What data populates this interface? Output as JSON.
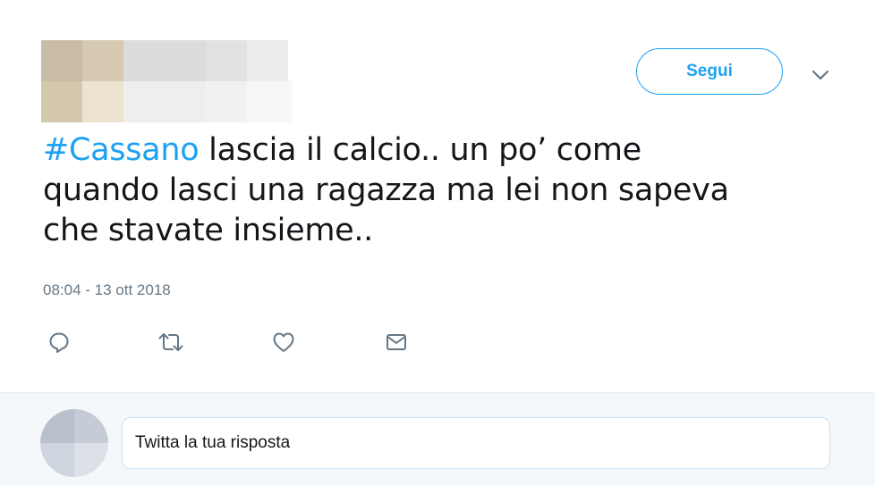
{
  "header": {
    "follow_label": "Segui"
  },
  "tweet": {
    "hashtag": "#Cassano",
    "text_line1_rest": " lascia il calcio.. un po’ come",
    "text_line2": "quando lasci una ragazza ma lei non sapeva",
    "text_line3": "che stavate insieme..",
    "timestamp": "08:04 - 13 ott 2018"
  },
  "actions": {
    "reply_icon": "reply-icon",
    "retweet_icon": "retweet-icon",
    "like_icon": "heart-icon",
    "dm_icon": "envelope-icon"
  },
  "reply": {
    "placeholder": "Twitta la tua risposta"
  },
  "colors": {
    "accent": "#1da1f2",
    "text": "#14171a",
    "muted": "#657786",
    "reply_bg": "#f5f8fa"
  }
}
